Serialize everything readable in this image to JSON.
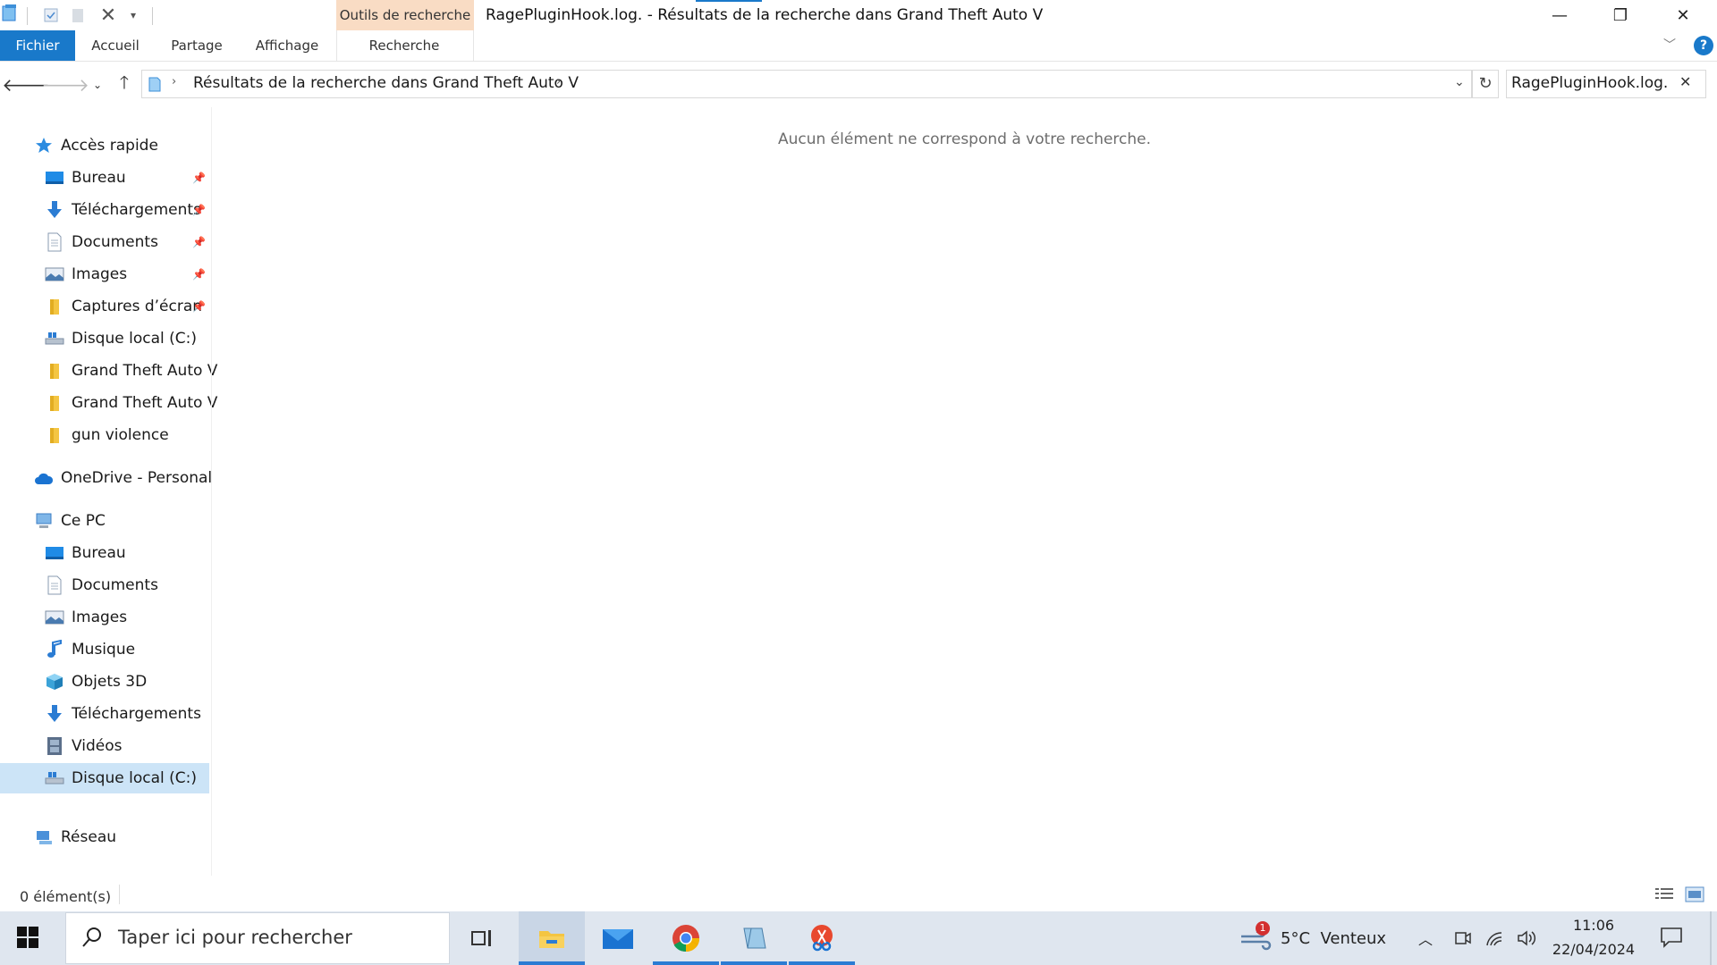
{
  "window": {
    "title": "RagePluginHook.log. - Résultats de la recherche dans Grand Theft Auto V",
    "context_tab_group": "Outils de recherche",
    "controls": {
      "minimize": "—",
      "restore": "❐",
      "close": "✕"
    }
  },
  "ribbon": {
    "tabs": [
      "Fichier",
      "Accueil",
      "Partage",
      "Affichage",
      "Recherche"
    ],
    "help": "?"
  },
  "address": {
    "path": "Résultats de la recherche dans Grand Theft Auto V",
    "search_value": "RagePluginHook.log."
  },
  "sidebar": {
    "quick_access": "Accès rapide",
    "quick_items": [
      {
        "label": "Bureau",
        "icon": "desktop-icon",
        "pinned": true
      },
      {
        "label": "Téléchargements",
        "icon": "download-icon",
        "pinned": true
      },
      {
        "label": "Documents",
        "icon": "document-icon",
        "pinned": true
      },
      {
        "label": "Images",
        "icon": "image-icon",
        "pinned": true
      },
      {
        "label": "Captures d’écran",
        "icon": "folder-icon",
        "pinned": true
      },
      {
        "label": "Disque local (C:)",
        "icon": "drive-icon",
        "pinned": false
      },
      {
        "label": "Grand Theft Auto V",
        "icon": "folder-icon",
        "pinned": false
      },
      {
        "label": "Grand Theft Auto V",
        "icon": "folder-icon",
        "pinned": false
      },
      {
        "label": "gun violence",
        "icon": "folder-icon",
        "pinned": false
      }
    ],
    "onedrive": "OneDrive - Personal",
    "this_pc": "Ce PC",
    "pc_items": [
      {
        "label": "Bureau",
        "icon": "desktop-icon"
      },
      {
        "label": "Documents",
        "icon": "document-icon"
      },
      {
        "label": "Images",
        "icon": "image-icon"
      },
      {
        "label": "Musique",
        "icon": "music-icon"
      },
      {
        "label": "Objets 3D",
        "icon": "cube-icon"
      },
      {
        "label": "Téléchargements",
        "icon": "download-icon"
      },
      {
        "label": "Vidéos",
        "icon": "video-icon"
      },
      {
        "label": "Disque local (C:)",
        "icon": "drive-icon"
      }
    ],
    "network": "Réseau"
  },
  "main": {
    "empty_message": "Aucun élément ne correspond à votre recherche."
  },
  "status": {
    "count": "0 élément(s)"
  },
  "taskbar": {
    "search_placeholder": "Taper ici pour rechercher",
    "weather": "5°C  Venteux",
    "weather_badge": "1",
    "time": "11:06",
    "date": "22/04/2024"
  },
  "colors": {
    "accent": "#1979ca",
    "context_tab": "#f9dcc4",
    "selected": "#cce4f7",
    "taskbar": "#dfe6ef"
  }
}
